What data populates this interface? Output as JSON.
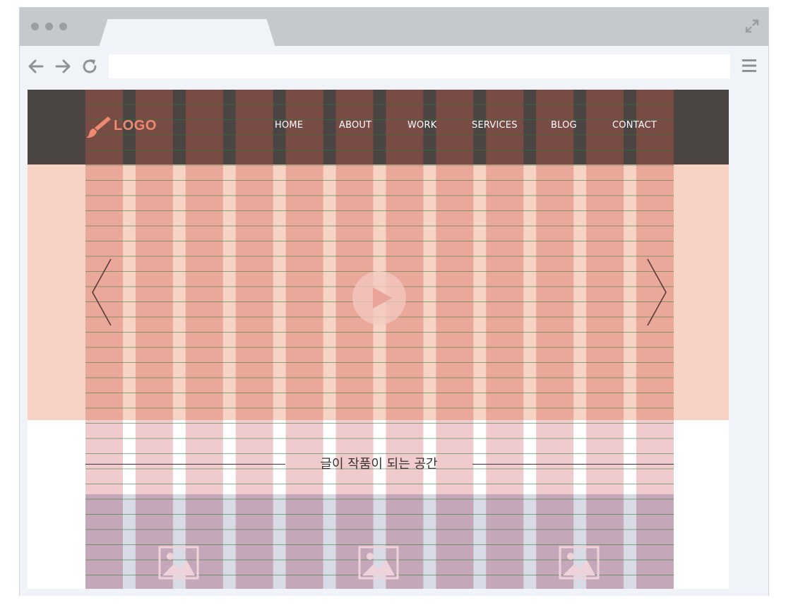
{
  "colors": {
    "header_bg": "#4a4443",
    "hero_bg": "#f7d3c6",
    "column_overlay": "#d25a4a",
    "baseline_line": "#2e7d32",
    "logo_accent": "#ee8a72",
    "nav_text": "#ffffff"
  },
  "browser": {
    "address_value": "",
    "icons": [
      "back-arrow-icon",
      "forward-arrow-icon",
      "reload-icon",
      "menu-icon",
      "expand-icon"
    ]
  },
  "header": {
    "logo_text": "LOGO",
    "logo_icon": "paintbrush-icon",
    "nav": [
      "HOME",
      "ABOUT",
      "WORK",
      "SERVICES",
      "BLOG",
      "CONTACT"
    ]
  },
  "hero": {
    "play_icon": "play-icon",
    "prev_icon": "chevron-left-icon",
    "next_icon": "chevron-right-icon"
  },
  "section": {
    "title": "글이 작품이 되는 공간"
  },
  "gallery": {
    "icons": [
      "image-placeholder-icon",
      "image-placeholder-icon",
      "image-placeholder-icon"
    ]
  },
  "grid_overlay": {
    "columns": 12
  }
}
